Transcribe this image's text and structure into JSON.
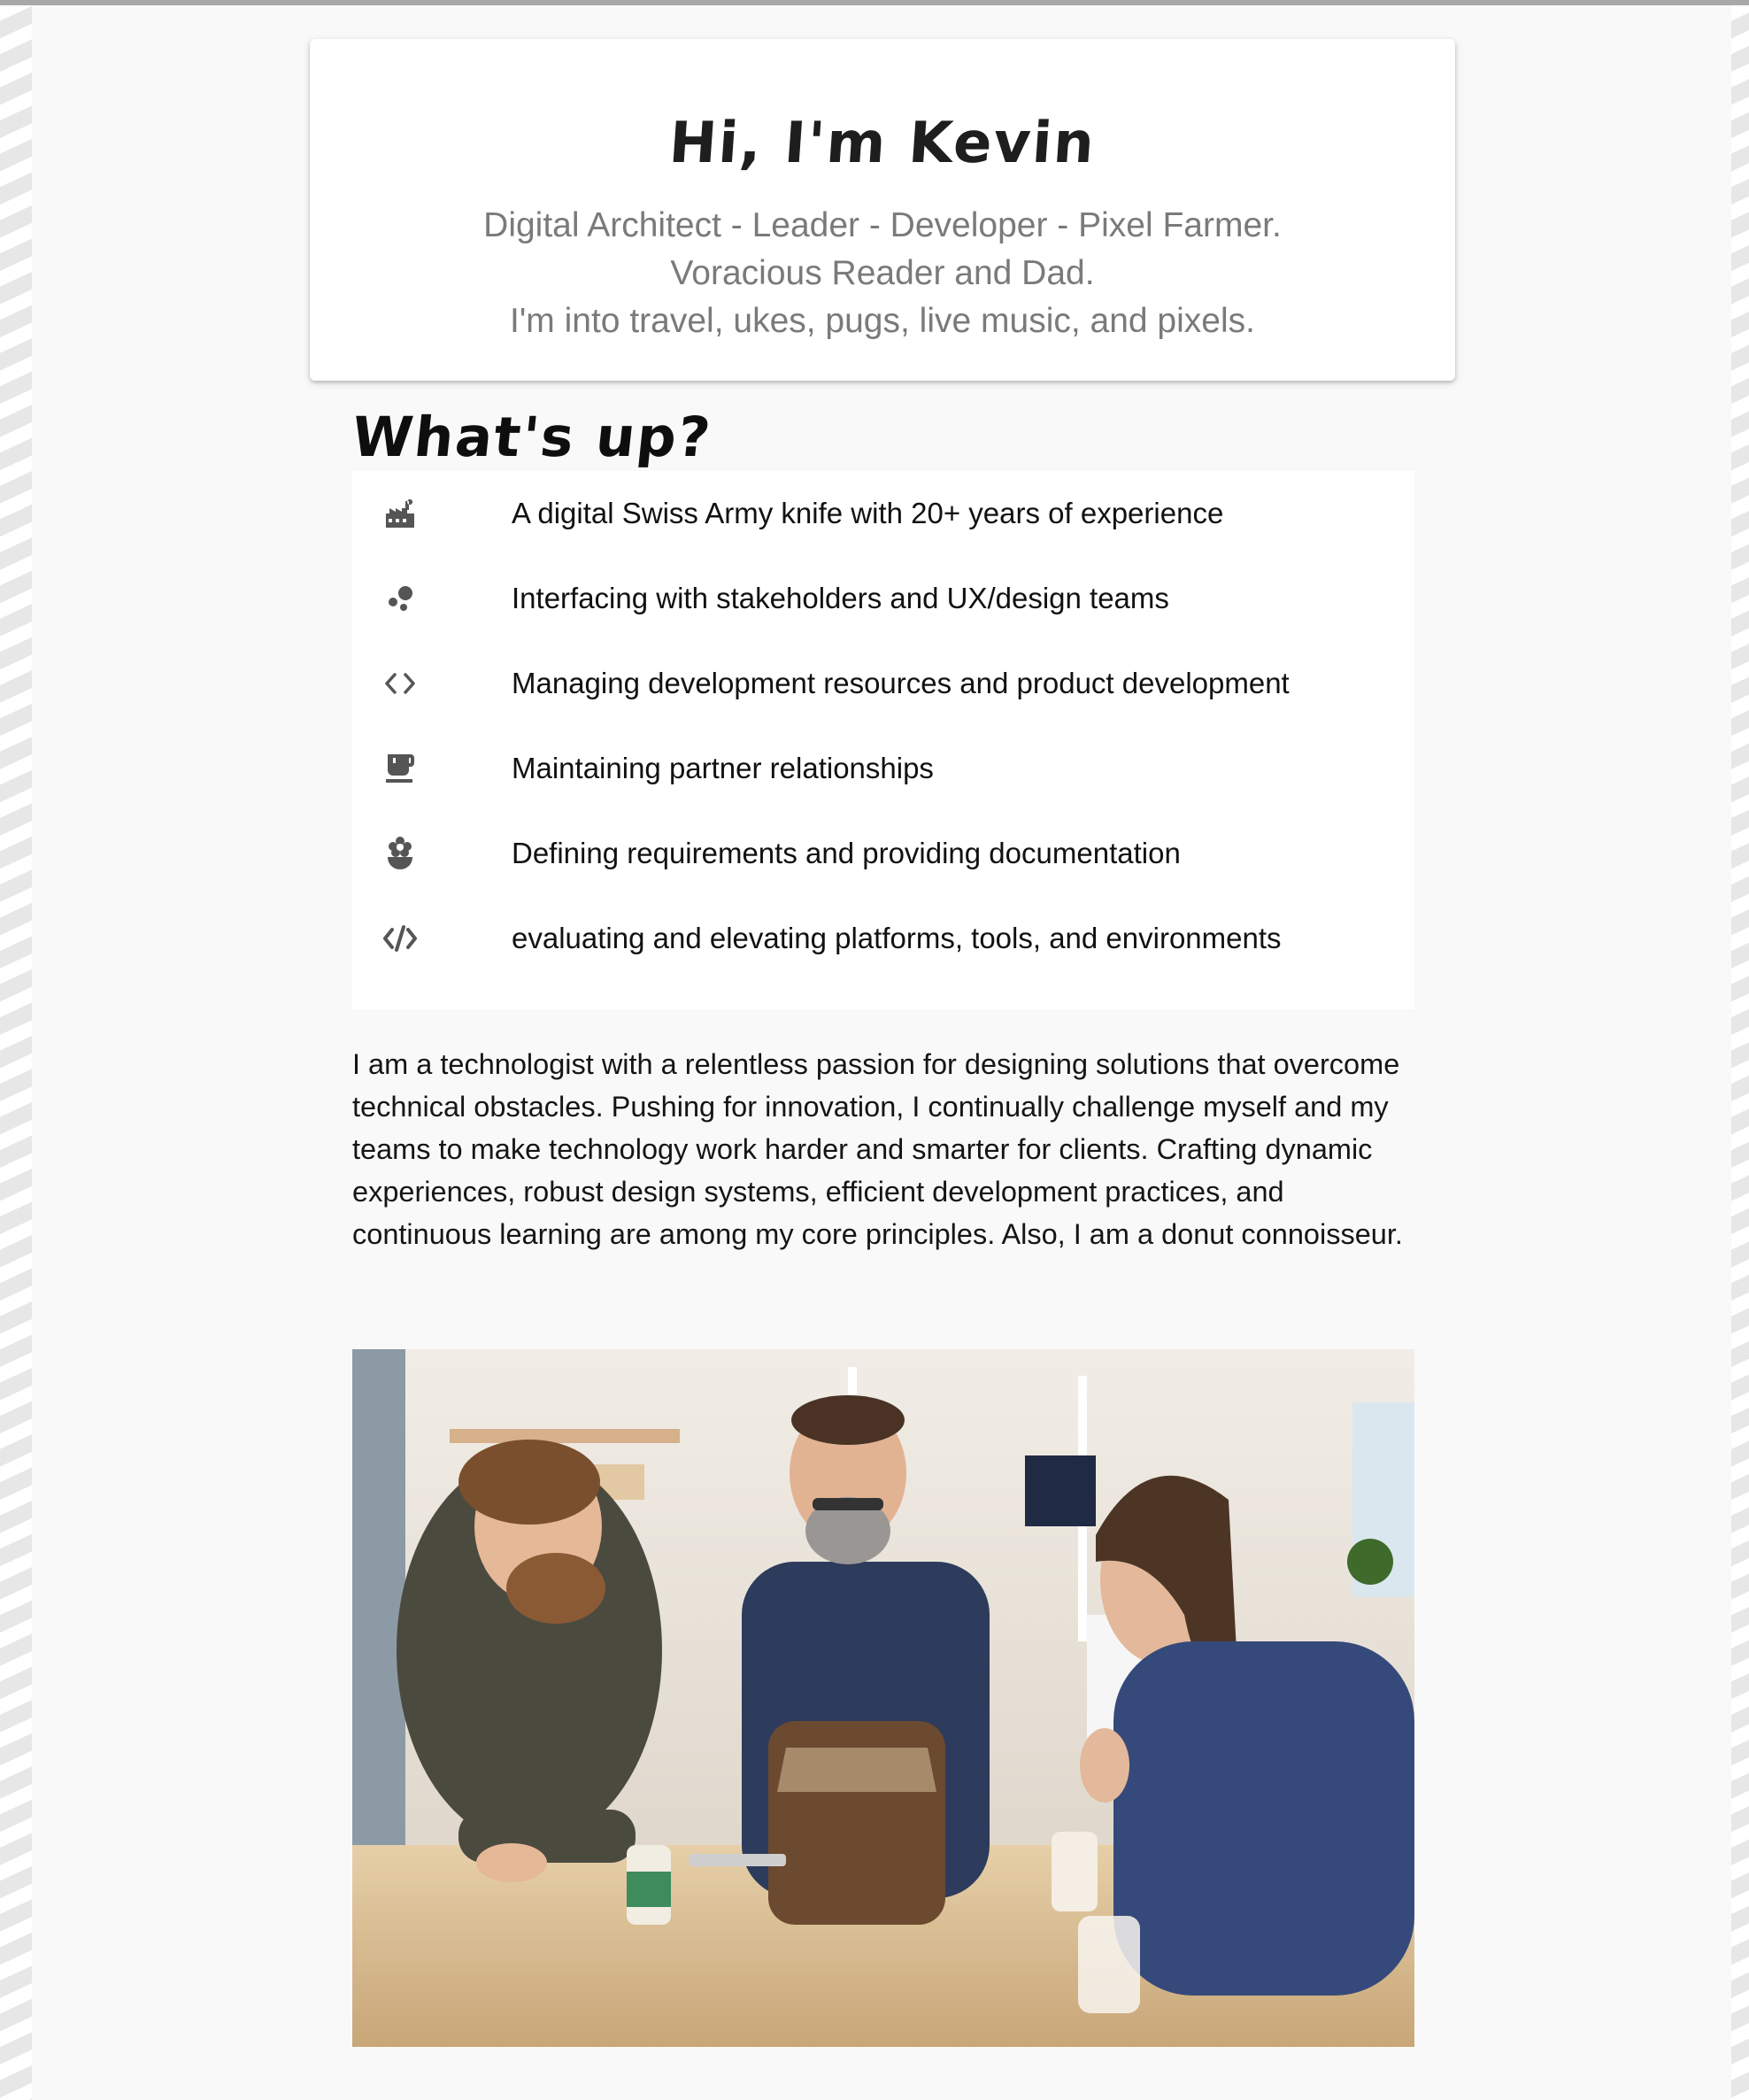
{
  "hero": {
    "title": "Hi, I'm Kevin",
    "lines": [
      "Digital Architect - Leader - Developer - Pixel Farmer.",
      "Voracious Reader and Dad.",
      "I'm into travel, ukes, pugs, live music, and pixels."
    ]
  },
  "whats_up": {
    "title": "What's up?",
    "items": [
      {
        "icon": "factory-icon",
        "label": "A digital Swiss Army knife with 20+ years of experience"
      },
      {
        "icon": "bubbles-icon",
        "label": "Interfacing with stakeholders and UX/design teams"
      },
      {
        "icon": "code-brackets-icon",
        "label": "Managing development resources and product development"
      },
      {
        "icon": "coffee-icon",
        "label": "Maintaining partner relationships"
      },
      {
        "icon": "flower-pot-icon",
        "label": "Defining requirements and providing documentation"
      },
      {
        "icon": "code-slash-icon",
        "label": "evaluating and elevating platforms, tools, and environments"
      }
    ]
  },
  "bio": {
    "text": "I am a technologist with a relentless passion for designing solutions that overcome technical obstacles. Pushing for innovation, I continually challenge myself and my teams to make technology work harder and smarter for clients. Crafting dynamic experiences, robust design systems, efficient development practices, and continuous learning are among my core principles. Also, I am a donut connoisseur."
  },
  "colors": {
    "background": "#f9f9f9",
    "card": "#ffffff",
    "title": "#1e1e1e",
    "subtitle": "#7a7a7a",
    "icon": "#555555",
    "text": "#111111"
  }
}
